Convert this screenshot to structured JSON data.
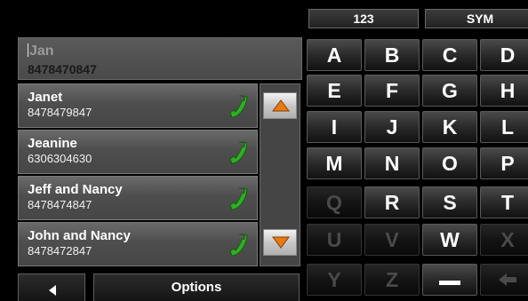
{
  "search": {
    "name_value": "Jan",
    "number_value": "8478470847"
  },
  "contacts": [
    {
      "name": "Janet",
      "number": "8478479847"
    },
    {
      "name": "Jeanine",
      "number": "6306304630"
    },
    {
      "name": "Jeff and Nancy",
      "number": "8478474847"
    },
    {
      "name": "John and Nancy",
      "number": "8478472847"
    }
  ],
  "bottom": {
    "options_label": "Options"
  },
  "keyboard": {
    "mode_tabs": [
      "123",
      "SYM"
    ],
    "rows": [
      [
        "A",
        "B",
        "C",
        "D"
      ],
      [
        "E",
        "F",
        "G",
        "H"
      ],
      [
        "I",
        "J",
        "K",
        "L"
      ],
      [
        "M",
        "N",
        "O",
        "P"
      ],
      [
        "Q",
        "R",
        "S",
        "T"
      ],
      [
        "U",
        "V",
        "W",
        "X"
      ],
      [
        "Y",
        "Z",
        "space",
        "backspace"
      ]
    ],
    "disabled_keys": [
      "Q",
      "U",
      "V",
      "X",
      "Y",
      "Z",
      "backspace"
    ]
  },
  "icons": {
    "phone": "phone-icon",
    "scroll_up": "triangle-up-icon",
    "scroll_down": "triangle-down-icon",
    "back": "triangle-left-icon",
    "space": "space-bar-icon",
    "backspace": "arrow-left-icon"
  },
  "colors": {
    "background": "#000000",
    "phone_green": "#2fae25",
    "scroll_arrow_orange": "#e87a14",
    "disabled_key_text": "#4a4a4a"
  }
}
